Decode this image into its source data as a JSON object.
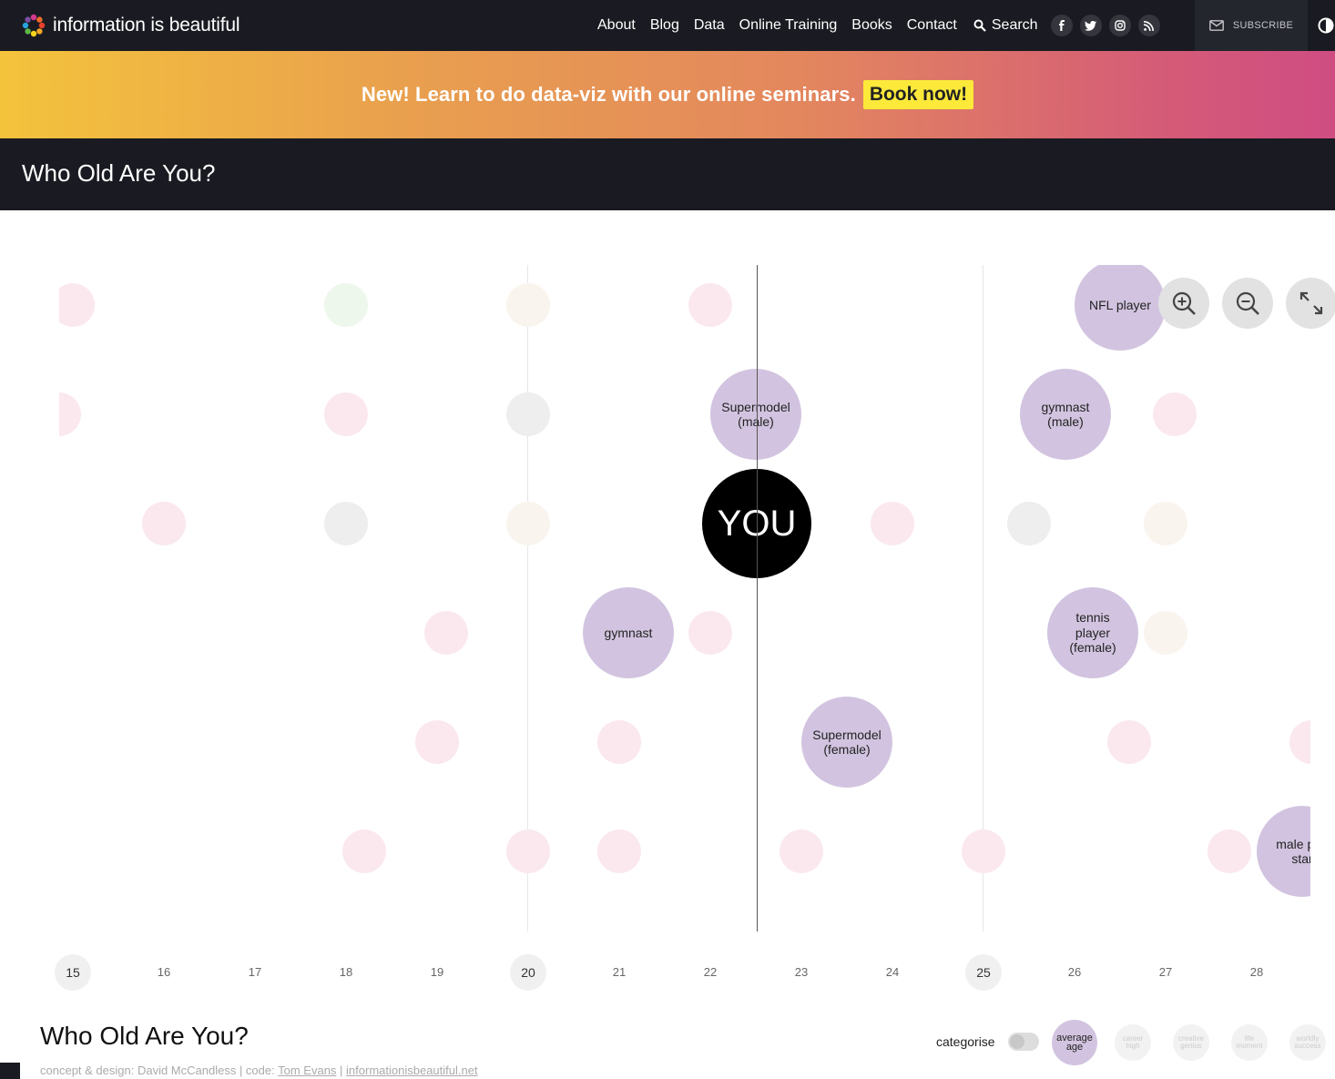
{
  "brand": {
    "name": "information is beautiful",
    "logo_colors": [
      "#e8412c",
      "#f4a623",
      "#f7d51d",
      "#5cb947",
      "#27a3dd",
      "#7b4ea2",
      "#d63a8e",
      "#ee6a2a"
    ]
  },
  "nav": {
    "links": [
      "About",
      "Blog",
      "Data",
      "Online Training",
      "Books",
      "Contact"
    ],
    "search_label": "Search",
    "social_icons": [
      "facebook-icon",
      "twitter-icon",
      "instagram-icon",
      "rss-icon"
    ],
    "subscribe_label": "SUBSCRIBE"
  },
  "banner": {
    "text": "New! Learn to do data-viz with our online seminars.",
    "button": "Book now!"
  },
  "page_title": "Who Old Are You?",
  "chart_data": {
    "type": "scatter",
    "x_axis": {
      "ticks": [
        15,
        16,
        17,
        18,
        19,
        20,
        21,
        22,
        23,
        24,
        25,
        26,
        27,
        28
      ],
      "major_ticks": [
        15,
        20,
        25
      ],
      "visible_range": [
        14.85,
        28.6
      ]
    },
    "you_age": 22.5,
    "you_label": "YOU",
    "highlighted": [
      {
        "label": "NFL player",
        "age": 26.5,
        "row": 0
      },
      {
        "label": "Supermodel (male)",
        "age": 22.5,
        "row": 1
      },
      {
        "label": "gymnast (male)",
        "age": 25.9,
        "row": 1
      },
      {
        "label": "gymnast",
        "age": 21.1,
        "row": 3
      },
      {
        "label": "tennis player (female)",
        "age": 26.2,
        "row": 3
      },
      {
        "label": "Supermodel (female)",
        "age": 23.5,
        "row": 4
      },
      {
        "label": "male pop star",
        "age": 28.5,
        "row": 5
      }
    ],
    "faint": [
      {
        "age": 15.0,
        "row": 0,
        "color": "#fbe8ef"
      },
      {
        "age": 18.0,
        "row": 0,
        "color": "#eef7ec"
      },
      {
        "age": 20.0,
        "row": 0,
        "color": "#faf4ee"
      },
      {
        "age": 22.0,
        "row": 0,
        "color": "#fbe8ef"
      },
      {
        "age": 14.85,
        "row": 1,
        "color": "#fbe8ef"
      },
      {
        "age": 18.0,
        "row": 1,
        "color": "#fbe8ef"
      },
      {
        "age": 20.0,
        "row": 1,
        "color": "#eeeeee"
      },
      {
        "age": 27.1,
        "row": 1,
        "color": "#fbe8ef"
      },
      {
        "age": 16.0,
        "row": 2,
        "color": "#fbe8ef"
      },
      {
        "age": 18.0,
        "row": 2,
        "color": "#eeeeee"
      },
      {
        "age": 20.0,
        "row": 2,
        "color": "#faf4ee"
      },
      {
        "age": 24.0,
        "row": 2,
        "color": "#fbe8ef"
      },
      {
        "age": 25.5,
        "row": 2,
        "color": "#eeeeee"
      },
      {
        "age": 27.0,
        "row": 2,
        "color": "#faf4ee"
      },
      {
        "age": 19.1,
        "row": 3,
        "color": "#fbe8ef"
      },
      {
        "age": 22.0,
        "row": 3,
        "color": "#fbe8ef"
      },
      {
        "age": 27.0,
        "row": 3,
        "color": "#faf4ee"
      },
      {
        "age": 19.0,
        "row": 4,
        "color": "#fbe8ef"
      },
      {
        "age": 21.0,
        "row": 4,
        "color": "#fbe8ef"
      },
      {
        "age": 26.6,
        "row": 4,
        "color": "#fbe8ef"
      },
      {
        "age": 28.6,
        "row": 4,
        "color": "#fbe8ef"
      },
      {
        "age": 18.2,
        "row": 5,
        "color": "#fbe8ef"
      },
      {
        "age": 20.0,
        "row": 5,
        "color": "#fbe8ef"
      },
      {
        "age": 21.0,
        "row": 5,
        "color": "#fbe8ef"
      },
      {
        "age": 23.0,
        "row": 5,
        "color": "#fbe8ef"
      },
      {
        "age": 25.0,
        "row": 5,
        "color": "#fbe8ef"
      },
      {
        "age": 27.7,
        "row": 5,
        "color": "#fbe8ef"
      }
    ],
    "highlight_color": "#d2c4e0",
    "you_color": "#000000",
    "grid": true
  },
  "zoom_controls": [
    "zoom-in-icon",
    "zoom-out-icon",
    "expand-icon"
  ],
  "footer": {
    "title": "Who Old Are You?",
    "credit_prefix": "concept & design: David McCandless | code: ",
    "credit_code": "Tom Evans",
    "credit_sep": " | ",
    "credit_site": "informationisbeautiful.net",
    "categorise_label": "categorise",
    "categories": [
      {
        "label": "average age",
        "active": true
      },
      {
        "label": "career high",
        "active": false
      },
      {
        "label": "creative genius",
        "active": false
      },
      {
        "label": "life moment",
        "active": false
      },
      {
        "label": "worldly success",
        "active": false
      }
    ]
  }
}
